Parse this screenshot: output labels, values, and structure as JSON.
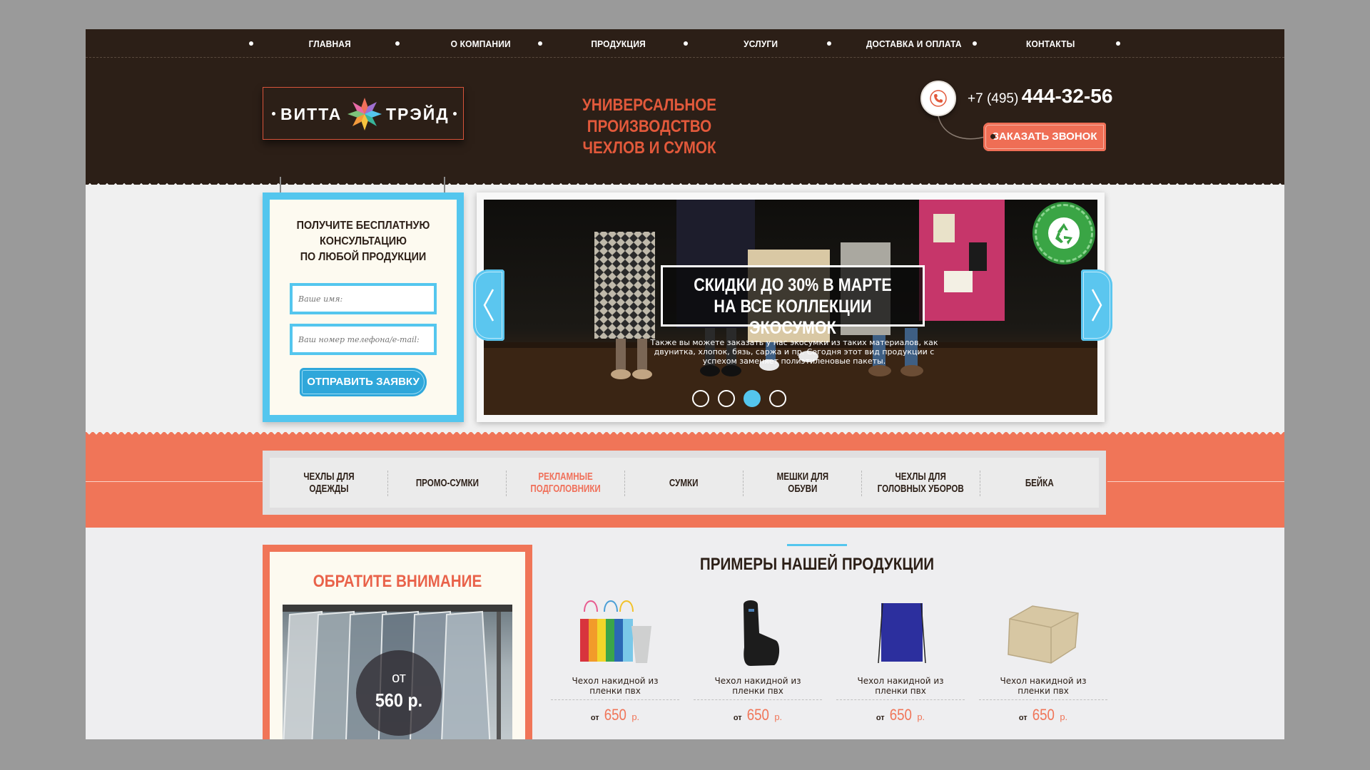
{
  "nav": {
    "items": [
      "ГЛАВНАЯ",
      "О КОМПАНИИ",
      "ПРОДУКЦИЯ",
      "УСЛУГИ",
      "ДОСТАВКА И ОПЛАТА",
      "КОНТАКТЫ"
    ]
  },
  "logo": {
    "left_text": "ВИТТА",
    "right_text": "ТРЭЙД"
  },
  "tagline": {
    "line1": "УНИВЕРСАЛЬНОЕ ПРОИЗВОДСТВО",
    "line2": "ЧЕХЛОВ И СУМОК"
  },
  "contact": {
    "phone_code": "+7 (495)",
    "phone_number": "444-32-56",
    "callback_label": "ЗАКАЗАТЬ ЗВОНОК",
    "icon": "phone-icon"
  },
  "consult_form": {
    "title_line1": "ПОЛУЧИТЕ БЕСПЛАТНУЮ",
    "title_line2": "КОНСУЛЬТАЦИЮ",
    "title_line3": "ПО ЛЮБОЙ ПРОДУКЦИИ",
    "name_placeholder": "Ваше имя:",
    "contact_placeholder": "Ваш номер телефона/e-mail:",
    "submit_label": "ОТПРАВИТЬ ЗАЯВКУ"
  },
  "slider": {
    "headline_line1": "СКИДКИ ДО 30% В МАРТЕ",
    "headline_line2": "НА ВСЕ КОЛЛЕКЦИИ ЭКОСУМОК",
    "description": "Также вы можете заказать у нас экосумки из таких материалов, как двунитка, хлопок, бязь, саржа и пр. Сегодня этот вид продукции с успехом заменяет полиэтиленовые пакеты.",
    "slide_count": 4,
    "active_slide": 3,
    "badge_icon": "recycle-icon"
  },
  "categories": [
    {
      "line1": "ЧЕХЛЫ ДЛЯ",
      "line2": "ОДЕЖДЫ",
      "active": false
    },
    {
      "line1": "ПРОМО-СУМКИ",
      "line2": "",
      "active": false
    },
    {
      "line1": "РЕКЛАМНЫЕ",
      "line2": "ПОДГОЛОВНИКИ",
      "active": true
    },
    {
      "line1": "СУМКИ",
      "line2": "",
      "active": false
    },
    {
      "line1": "МЕШКИ ДЛЯ",
      "line2": "ОБУВИ",
      "active": false
    },
    {
      "line1": "ЧЕХЛЫ ДЛЯ",
      "line2": "ГОЛОВНЫХ УБОРОВ",
      "active": false
    },
    {
      "line1": "БЕЙКА",
      "line2": "",
      "active": false
    }
  ],
  "notice": {
    "title": "ОБРАТИТЕ ВНИМАНИЕ",
    "price_prefix": "от",
    "price_value": "560 р."
  },
  "products": {
    "title": "ПРИМЕРЫ НАШЕЙ ПРОДУКЦИИ",
    "items": [
      {
        "name_line1": "Чехол накидной из",
        "name_line2": "пленки пвх",
        "price_prefix": "от",
        "price": "650",
        "currency": "р."
      },
      {
        "name_line1": "Чехол накидной из",
        "name_line2": "пленки пвх",
        "price_prefix": "от",
        "price": "650",
        "currency": "р."
      },
      {
        "name_line1": "Чехол накидной из",
        "name_line2": "пленки пвх",
        "price_prefix": "от",
        "price": "650",
        "currency": "р."
      },
      {
        "name_line1": "Чехол накидной из",
        "name_line2": "пленки пвх",
        "price_prefix": "от",
        "price": "650",
        "currency": "р."
      }
    ]
  },
  "colors": {
    "header_brown": "#2c1f17",
    "accent_orange": "#f07558",
    "accent_blue": "#54c6ee",
    "eco_green": "#3aa545"
  }
}
